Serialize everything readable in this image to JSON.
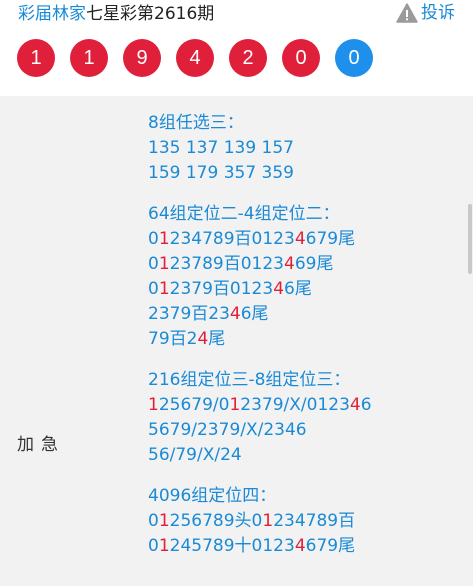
{
  "header": {
    "author": "彩届林家",
    "title_rest": "七星彩第2616期",
    "report_label": "投诉",
    "report_icon": "warning-triangle-icon"
  },
  "numbers": [
    {
      "value": "1",
      "color": "#e0203a"
    },
    {
      "value": "1",
      "color": "#e0203a"
    },
    {
      "value": "9",
      "color": "#e0203a"
    },
    {
      "value": "4",
      "color": "#e0203a"
    },
    {
      "value": "2",
      "color": "#e0203a"
    },
    {
      "value": "0",
      "color": "#e0203a"
    },
    {
      "value": "0",
      "color": "#1e90ec"
    }
  ],
  "content": {
    "side_label": "加急",
    "lines": [
      [
        {
          "t": "8组任选三："
        }
      ],
      [
        {
          "t": "135 137 139 157"
        }
      ],
      [
        {
          "t": "159 179 357 359"
        }
      ],
      [],
      [
        {
          "t": "64组定位二-4组定位二："
        }
      ],
      [
        {
          "t": "0"
        },
        {
          "t": "1",
          "hl": true
        },
        {
          "t": "234789百0123"
        },
        {
          "t": "4",
          "hl": true
        },
        {
          "t": "679尾"
        }
      ],
      [
        {
          "t": "0"
        },
        {
          "t": "1",
          "hl": true
        },
        {
          "t": "23789百0123"
        },
        {
          "t": "4",
          "hl": true
        },
        {
          "t": "69尾"
        }
      ],
      [
        {
          "t": "0"
        },
        {
          "t": "1",
          "hl": true
        },
        {
          "t": "2379百0123"
        },
        {
          "t": "4",
          "hl": true
        },
        {
          "t": "6尾"
        }
      ],
      [
        {
          "t": "2379百23"
        },
        {
          "t": "4",
          "hl": true
        },
        {
          "t": "6尾"
        }
      ],
      [
        {
          "t": "79百2"
        },
        {
          "t": "4",
          "hl": true
        },
        {
          "t": "尾"
        }
      ],
      [],
      [
        {
          "t": "216组定位三-8组定位三："
        }
      ],
      [
        {
          "t": "1",
          "hl": true
        },
        {
          "t": "25679/0"
        },
        {
          "t": "1",
          "hl": true
        },
        {
          "t": "2379/X/0123"
        },
        {
          "t": "4",
          "hl": true
        },
        {
          "t": "6"
        }
      ],
      [
        {
          "t": "5679/2379/X/2346"
        }
      ],
      [
        {
          "t": "56/79/X/24"
        }
      ],
      [],
      [
        {
          "t": "4096组定位四："
        }
      ],
      [
        {
          "t": "0"
        },
        {
          "t": "1",
          "hl": true
        },
        {
          "t": "256789头0"
        },
        {
          "t": "1",
          "hl": true
        },
        {
          "t": "234789百"
        }
      ],
      [
        {
          "t": "0"
        },
        {
          "t": "1",
          "hl": true
        },
        {
          "t": "245789十0123"
        },
        {
          "t": "4",
          "hl": true
        },
        {
          "t": "679尾"
        }
      ]
    ]
  }
}
